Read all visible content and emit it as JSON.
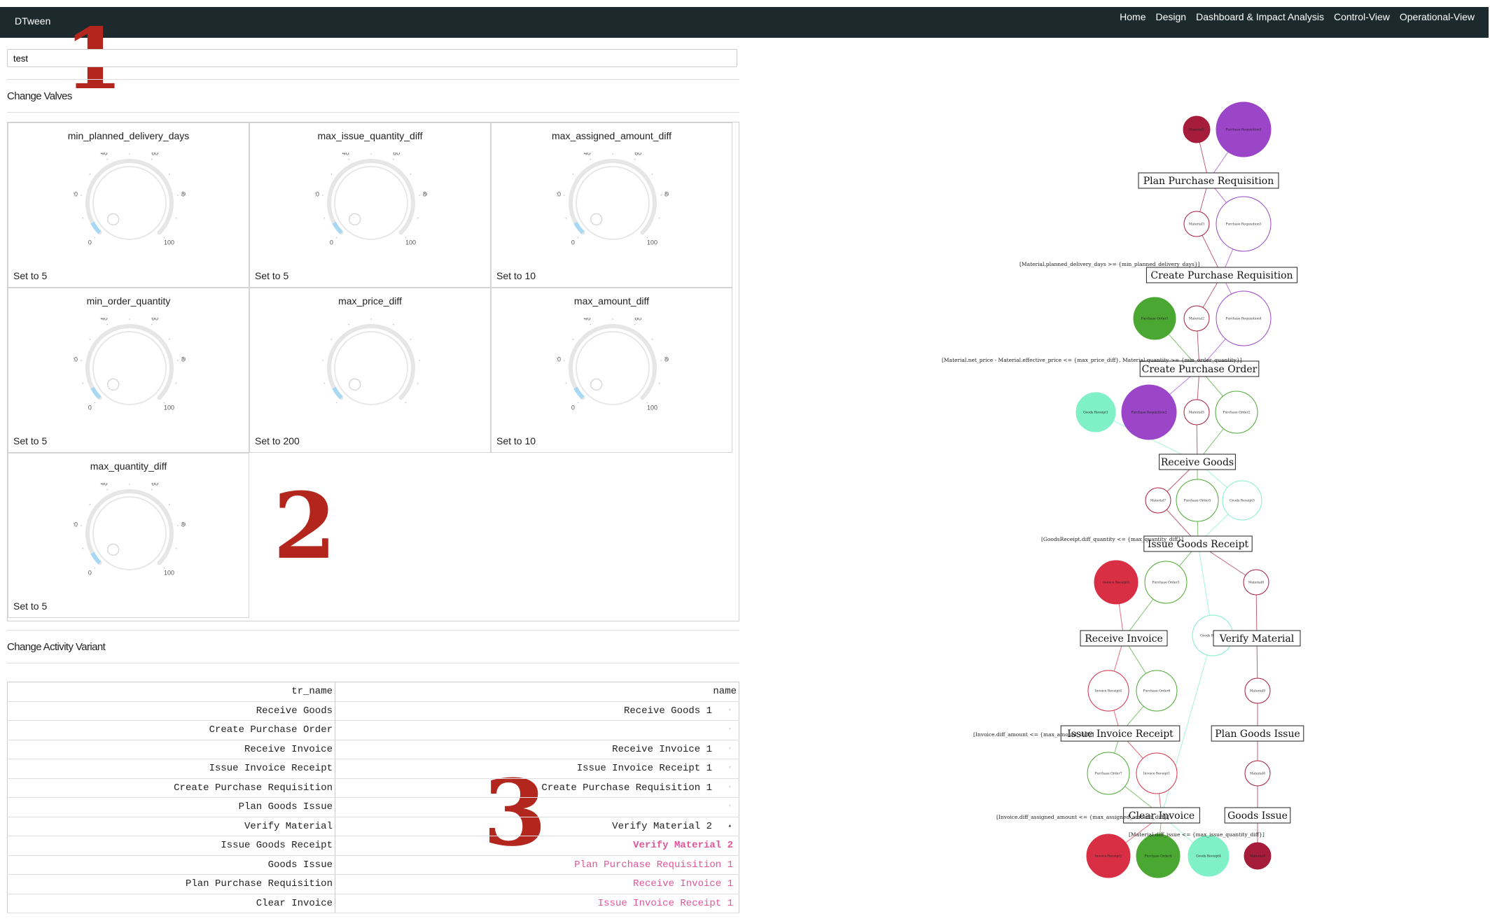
{
  "app": {
    "brand": "DTween"
  },
  "nav": [
    "Home",
    "Design",
    "Dashboard & Impact Analysis",
    "Control-View",
    "Operational-View"
  ],
  "markers": [
    "1",
    "2",
    "3"
  ],
  "search": {
    "value": "test"
  },
  "valves": {
    "title": "Change Valves",
    "knobs": [
      {
        "name": "min_planned_delivery_days",
        "set_label": "Set to 5",
        "value": 5
      },
      {
        "name": "max_issue_quantity_diff",
        "set_label": "Set to 5",
        "value": 5
      },
      {
        "name": "max_assigned_amount_diff",
        "set_label": "Set to 10",
        "value": 10
      },
      {
        "name": "min_order_quantity",
        "set_label": "Set to 5",
        "value": 5
      },
      {
        "name": "max_price_diff",
        "set_label": "Set to 200",
        "value": 200
      },
      {
        "name": "max_amount_diff",
        "set_label": "Set to 10",
        "value": 10
      },
      {
        "name": "max_quantity_diff",
        "set_label": "Set to 5",
        "value": 5
      }
    ],
    "ticks": [
      "0",
      "20",
      "40",
      "60",
      "80",
      "100"
    ]
  },
  "variant": {
    "title": "Change Activity Variant",
    "headers": [
      "tr_name",
      "name"
    ],
    "rows": [
      {
        "tr_name": "Receive Goods",
        "name": "Receive Goods 1"
      },
      {
        "tr_name": "Create Purchase Order",
        "name": ""
      },
      {
        "tr_name": "Receive Invoice",
        "name": "Receive Invoice 1"
      },
      {
        "tr_name": "Issue Invoice Receipt",
        "name": "Issue Invoice Receipt 1"
      },
      {
        "tr_name": "Create Purchase Requisition",
        "name": "Create Purchase Requisition 1"
      },
      {
        "tr_name": "Plan Goods Issue",
        "name": ""
      },
      {
        "tr_name": "Verify Material",
        "name": "Verify Material 2"
      },
      {
        "tr_name": "Issue Goods Receipt",
        "name": "Verify Material 2"
      },
      {
        "tr_name": "Goods Issue",
        "name": "Plan Purchase Requisition 1"
      },
      {
        "tr_name": "Plan Purchase Requisition",
        "name": "Receive Invoice 1"
      },
      {
        "tr_name": "Clear Invoice",
        "name": "Issue Invoice Receipt 1"
      }
    ]
  },
  "graph": {
    "colors": {
      "crimson": "#a51d3a",
      "purple": "#9b45c9",
      "green": "#4aa832",
      "mint": "#7ff0c8",
      "red": "#d92f45"
    },
    "transitions": [
      "Plan Purchase Requisition",
      "Create Purchase Requisition",
      "Create Purchase Order",
      "Receive Goods",
      "Issue Goods Receipt",
      "Receive Invoice",
      "Verify Material",
      "Issue Invoice Receipt",
      "Plan Goods Issue",
      "Clear Invoice",
      "Goods Issue"
    ],
    "guards": [
      "[Material.planned_delivery_days >= {min_planned_delivery_days}]",
      "[Material.net_price - Material.effective_price <= {max_price_diff}, Material.quantity >= {min_order_quantity}]",
      "[GoodsReceipt.diff_quantity <= {max_quantity_diff}]",
      "[Invoice.diff_amount <= {max_amount_diff}]",
      "[Invoice.diff_assigned_amount <= {max_assigned_amount_diff}]",
      "[Material.diff_issue <= {max_issue_quantity_diff}]"
    ],
    "places": [
      "Material1",
      "Purchase Requisition1",
      "Material3",
      "Purchase Requisition3",
      "Purchase Order1",
      "Material2",
      "Purchase Requisition4",
      "Goods Receipt1",
      "Purchase Requisition2",
      "Material5",
      "Purchase Order2",
      "Material7",
      "Purchase Order5",
      "Goods Receipt3",
      "Invoice Receipt5",
      "Purchase Order3",
      "Material8",
      "Goods Receipt2",
      "Invoice Receipt4",
      "Purchase Order6",
      "Material9",
      "Purchase Order7",
      "Invoice Receipt1",
      "Material6",
      "Invoice Receipt2",
      "Purchase Order4",
      "Goods Receipt4",
      "Material4"
    ]
  }
}
